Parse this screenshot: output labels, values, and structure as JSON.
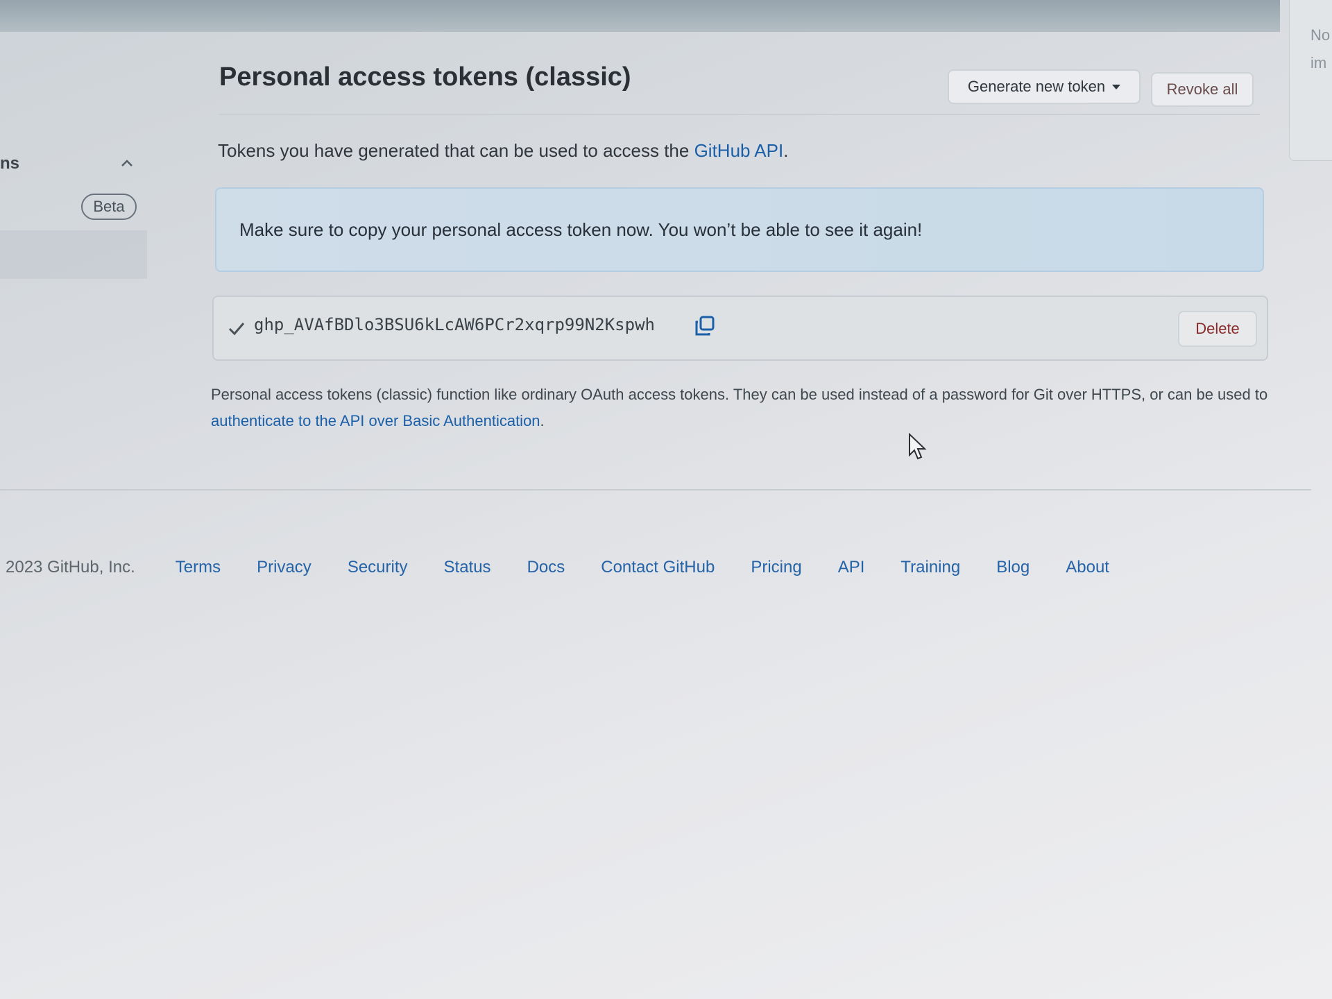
{
  "page": {
    "title": "Personal access tokens (classic)",
    "intro_text": "Tokens you have generated that can be used to access the ",
    "intro_link": "GitHub API",
    "intro_suffix": "."
  },
  "buttons": {
    "generate_label": "Generate new token",
    "revoke_label": "Revoke all",
    "delete_label": "Delete"
  },
  "flash": {
    "message": "Make sure to copy your personal access token now. You won’t be able to see it again!"
  },
  "token": {
    "value": "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"
  },
  "note": {
    "text": "Personal access tokens (classic) function like ordinary OAuth access tokens. They can be used instead of a password for Git over HTTPS, or can be used to ",
    "link": "authenticate to the API over Basic Authentication",
    "suffix": "."
  },
  "sidebar": {
    "label_fragment": "ns",
    "badge": "Beta"
  },
  "right_panel": {
    "line1": "No",
    "line2": "im"
  },
  "footer": {
    "copyright": "2023 GitHub, Inc.",
    "links": [
      "Terms",
      "Privacy",
      "Security",
      "Status",
      "Docs",
      "Contact GitHub",
      "Pricing",
      "API",
      "Training",
      "Blog",
      "About"
    ]
  },
  "colors": {
    "link": "#1b5fa8",
    "flash_bg": "#cfdde9",
    "danger_text": "#8a2b2b"
  },
  "icons": [
    "chevron-up-icon",
    "check-icon",
    "copy-icon",
    "caret-down-icon",
    "mouse-cursor-icon"
  ]
}
